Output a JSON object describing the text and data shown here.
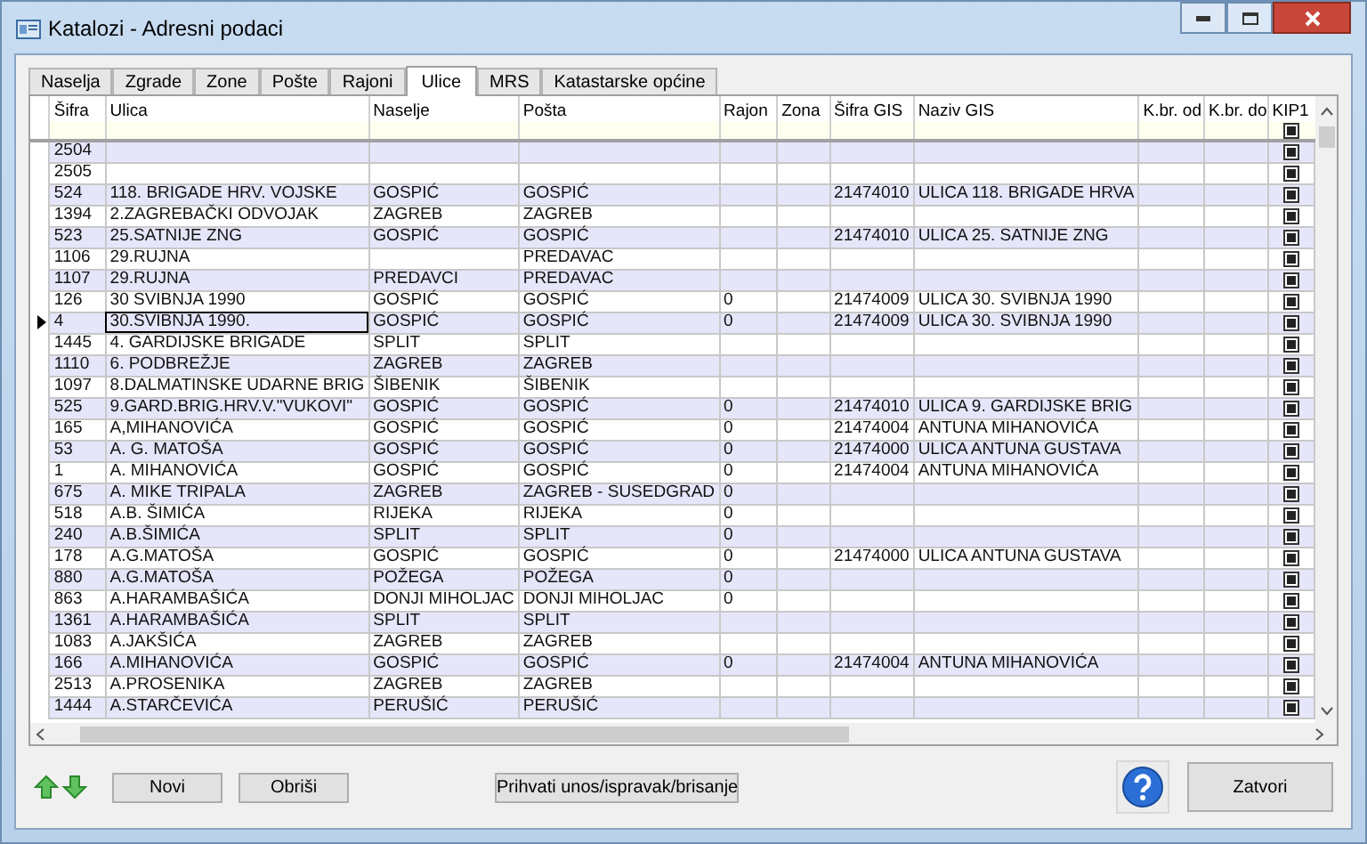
{
  "window": {
    "title": "Katalozi - Adresni podaci"
  },
  "tabs": [
    {
      "label": "Naselja",
      "selected": false
    },
    {
      "label": "Zgrade",
      "selected": false
    },
    {
      "label": "Zone",
      "selected": false
    },
    {
      "label": "Pošte",
      "selected": false
    },
    {
      "label": "Rajoni",
      "selected": false
    },
    {
      "label": "Ulice",
      "selected": true
    },
    {
      "label": "MRS",
      "selected": false
    },
    {
      "label": "Katastarske općine",
      "selected": false
    }
  ],
  "table": {
    "columns": [
      {
        "label": "Šifra"
      },
      {
        "label": "Ulica"
      },
      {
        "label": "Naselje"
      },
      {
        "label": "Pošta"
      },
      {
        "label": "Rajon"
      },
      {
        "label": "Zona"
      },
      {
        "label": "Šifra GIS"
      },
      {
        "label": "Naziv GIS"
      },
      {
        "label": "K.br. od"
      },
      {
        "label": "K.br. do"
      },
      {
        "label": "KIP1",
        "filter_checked": true
      }
    ],
    "rows": [
      {
        "sifra": "2504",
        "kip1": true,
        "selected": false
      },
      {
        "sifra": "2505",
        "kip1": true,
        "selected": false
      },
      {
        "sifra": "524",
        "ulica": "118. BRIGADE HRV. VOJSKE",
        "naselje": "GOSPIĆ",
        "posta": "GOSPIĆ",
        "sifra_gis": "21474010",
        "naziv_gis": "ULICA 118. BRIGADE HRVA",
        "kip1": true,
        "selected": false
      },
      {
        "sifra": "1394",
        "ulica": "2.ZAGREBAČKI ODVOJAK",
        "naselje": "ZAGREB",
        "posta": "ZAGREB",
        "kip1": true,
        "selected": false
      },
      {
        "sifra": "523",
        "ulica": "25.SATNIJE ZNG",
        "naselje": "GOSPIĆ",
        "posta": "GOSPIĆ",
        "sifra_gis": "21474010",
        "naziv_gis": "ULICA 25. SATNIJE ZNG",
        "kip1": true,
        "selected": false
      },
      {
        "sifra": "1106",
        "ulica": "29.RUJNA",
        "posta": "PREDAVAC",
        "kip1": true,
        "selected": false
      },
      {
        "sifra": "1107",
        "ulica": "29.RUJNA",
        "naselje": "PREDAVCI",
        "posta": "PREDAVAC",
        "kip1": true,
        "selected": false
      },
      {
        "sifra": "126",
        "ulica": "30 SVIBNJA 1990",
        "naselje": "GOSPIĆ",
        "posta": "GOSPIĆ",
        "rajon": "0",
        "sifra_gis": "21474009",
        "naziv_gis": "ULICA 30. SVIBNJA 1990",
        "kip1": true,
        "selected": false
      },
      {
        "sifra": "4",
        "ulica": "30.SVIBNJA 1990.",
        "naselje": "GOSPIĆ",
        "posta": "GOSPIĆ",
        "rajon": "0",
        "sifra_gis": "21474009",
        "naziv_gis": "ULICA 30. SVIBNJA 1990",
        "kip1": true,
        "selected": true
      },
      {
        "sifra": "1445",
        "ulica": "4. GARDIJSKE BRIGADE",
        "naselje": "SPLIT",
        "posta": "SPLIT",
        "kip1": true,
        "selected": false
      },
      {
        "sifra": "1110",
        "ulica": "6. PODBREŽJE",
        "naselje": "ZAGREB",
        "posta": "ZAGREB",
        "kip1": true,
        "selected": false
      },
      {
        "sifra": "1097",
        "ulica": "8.DALMATINSKE UDARNE BRIG",
        "naselje": "ŠIBENIK",
        "posta": "ŠIBENIK",
        "kip1": true,
        "selected": false
      },
      {
        "sifra": "525",
        "ulica": "9.GARD.BRIG.HRV.V.\"VUKOVI\"",
        "naselje": "GOSPIĆ",
        "posta": "GOSPIĆ",
        "rajon": "0",
        "sifra_gis": "21474010",
        "naziv_gis": "ULICA 9. GARDIJSKE BRIG",
        "kip1": true,
        "selected": false
      },
      {
        "sifra": "165",
        "ulica": "A,MIHANOVIĆA",
        "naselje": "GOSPIĆ",
        "posta": "GOSPIĆ",
        "rajon": "0",
        "sifra_gis": "21474004",
        "naziv_gis": "ANTUNA MIHANOVIĆA",
        "kip1": true,
        "selected": false
      },
      {
        "sifra": "53",
        "ulica": "A. G. MATOŠA",
        "naselje": "GOSPIĆ",
        "posta": "GOSPIĆ",
        "rajon": "0",
        "sifra_gis": "21474000",
        "naziv_gis": "ULICA ANTUNA GUSTAVA",
        "kip1": true,
        "selected": false
      },
      {
        "sifra": "1",
        "ulica": "A. MIHANOVIĆA",
        "naselje": "GOSPIĆ",
        "posta": "GOSPIĆ",
        "rajon": "0",
        "sifra_gis": "21474004",
        "naziv_gis": "ANTUNA MIHANOVIĆA",
        "kip1": true,
        "selected": false
      },
      {
        "sifra": "675",
        "ulica": "A. MIKE TRIPALA",
        "naselje": "ZAGREB",
        "posta": "ZAGREB - SUSEDGRAD",
        "rajon": "0",
        "kip1": true,
        "selected": false
      },
      {
        "sifra": "518",
        "ulica": "A.B. ŠIMIĆA",
        "naselje": "RIJEKA",
        "posta": "RIJEKA",
        "rajon": "0",
        "kip1": true,
        "selected": false
      },
      {
        "sifra": "240",
        "ulica": "A.B.ŠIMIĆA",
        "naselje": "SPLIT",
        "posta": "SPLIT",
        "rajon": "0",
        "kip1": true,
        "selected": false
      },
      {
        "sifra": "178",
        "ulica": "A.G.MATOŠA",
        "naselje": "GOSPIĆ",
        "posta": "GOSPIĆ",
        "rajon": "0",
        "sifra_gis": "21474000",
        "naziv_gis": "ULICA ANTUNA GUSTAVA",
        "kip1": true,
        "selected": false
      },
      {
        "sifra": "880",
        "ulica": "A.G.MATOŠA",
        "naselje": "POŽEGA",
        "posta": "POŽEGA",
        "rajon": "0",
        "kip1": true,
        "selected": false
      },
      {
        "sifra": "863",
        "ulica": "A.HARAMBAŠIĆA",
        "naselje": "DONJI MIHOLJAC",
        "posta": "DONJI MIHOLJAC",
        "rajon": "0",
        "kip1": true,
        "selected": false
      },
      {
        "sifra": "1361",
        "ulica": "A.HARAMBAŠIĆA",
        "naselje": "SPLIT",
        "posta": "SPLIT",
        "kip1": true,
        "selected": false
      },
      {
        "sifra": "1083",
        "ulica": "A.JAKŠIĆA",
        "naselje": "ZAGREB",
        "posta": "ZAGREB",
        "kip1": true,
        "selected": false
      },
      {
        "sifra": "166",
        "ulica": "A.MIHANOVIĆA",
        "naselje": "GOSPIĆ",
        "posta": "GOSPIĆ",
        "rajon": "0",
        "sifra_gis": "21474004",
        "naziv_gis": "ANTUNA MIHANOVIĆA",
        "kip1": true,
        "selected": false
      },
      {
        "sifra": "2513",
        "ulica": "A.PROSENIKA",
        "naselje": "ZAGREB",
        "posta": "ZAGREB",
        "kip1": true,
        "selected": false
      },
      {
        "sifra": "1444",
        "ulica": "A.STARČEVIĆA",
        "naselje": "PERUŠIĆ",
        "posta": "PERUŠIĆ",
        "kip1": true,
        "selected": false
      }
    ]
  },
  "buttons": {
    "new": "Novi",
    "delete": "Obriši",
    "accept": "Prihvati unos/ispravak/brisanje",
    "close": "Zatvori"
  }
}
